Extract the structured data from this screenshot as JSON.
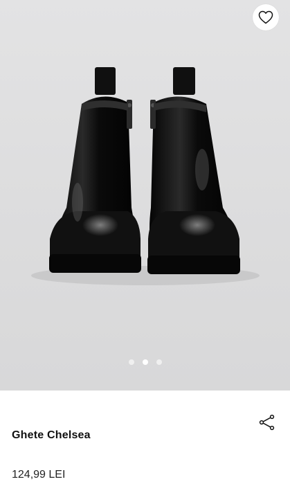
{
  "product": {
    "title": "Ghete Chelsea",
    "price": "124,99 LEI",
    "image_alt_icon": "chelsea-boots-photo"
  },
  "gallery": {
    "image_count": 3,
    "active_index": 1
  },
  "actions": {
    "favorite_icon": "heart-icon",
    "share_icon": "share-icon"
  },
  "colors": {
    "background": "#dcdcdd",
    "text": "#111111",
    "boot": "#0d0d0d"
  }
}
